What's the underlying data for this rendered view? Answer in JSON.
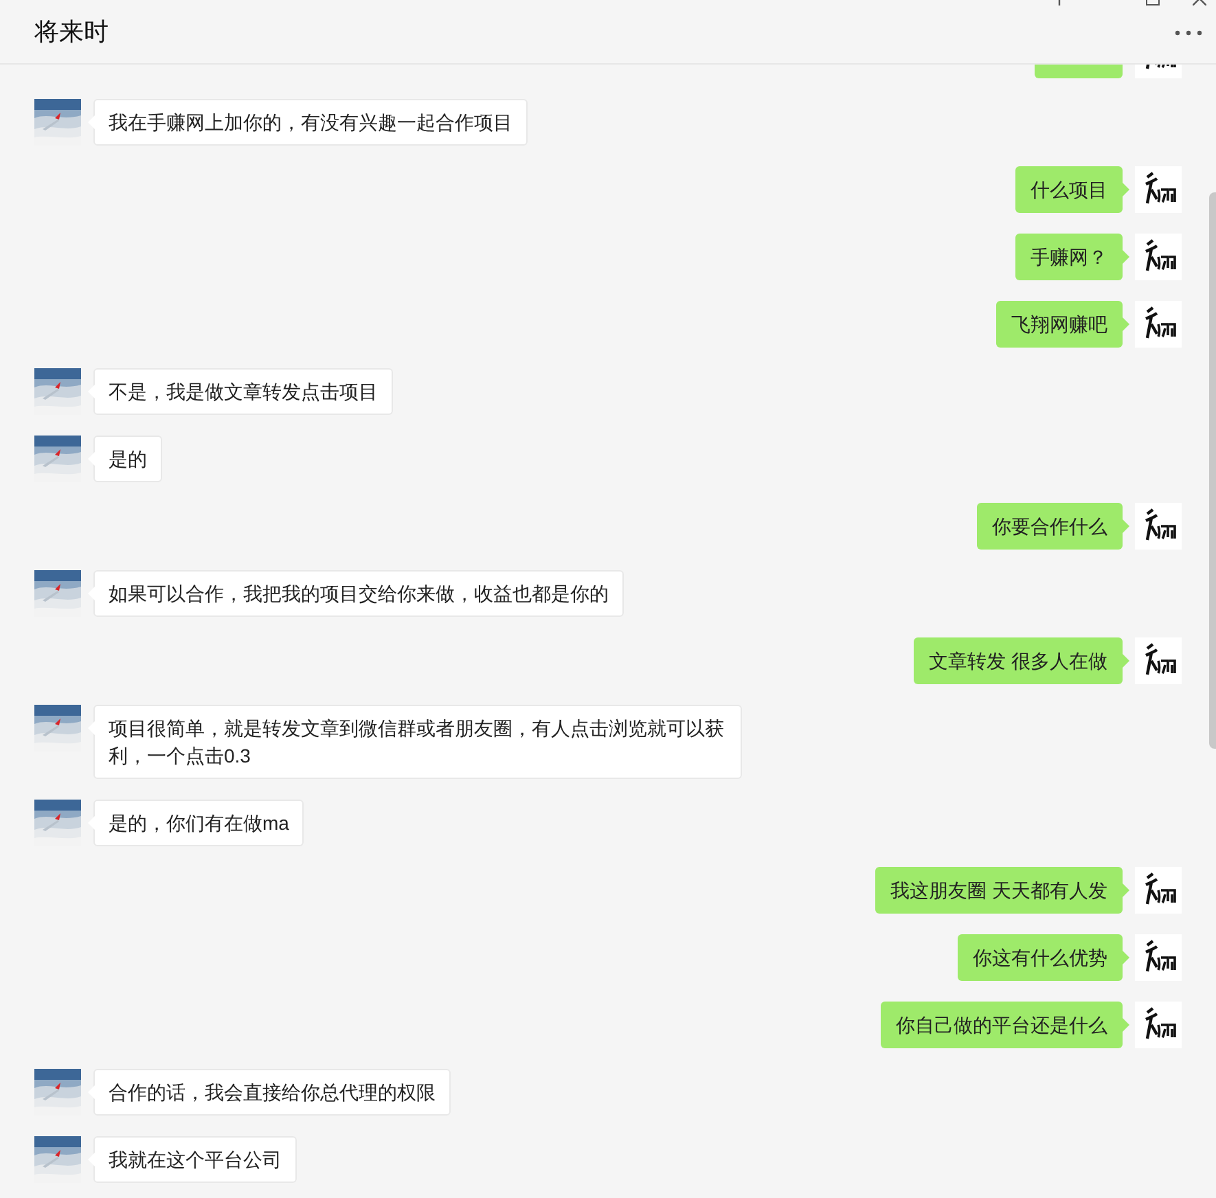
{
  "window": {
    "title": "将来时"
  },
  "messages": [
    {
      "kind": "sent",
      "cut": true
    },
    {
      "kind": "received",
      "text": "我在手赚网上加你的，有没有兴趣一起合作项目"
    },
    {
      "kind": "sent",
      "text": "什么项目"
    },
    {
      "kind": "sent",
      "text": "手赚网？"
    },
    {
      "kind": "sent",
      "text": "飞翔网赚吧"
    },
    {
      "kind": "received",
      "text": "不是，我是做文章转发点击项目"
    },
    {
      "kind": "received",
      "text": "是的"
    },
    {
      "kind": "sent",
      "text": "你要合作什么"
    },
    {
      "kind": "received",
      "text": "如果可以合作，我把我的项目交给你来做，收益也都是你的"
    },
    {
      "kind": "sent",
      "text": "文章转发 很多人在做"
    },
    {
      "kind": "received",
      "text": "项目很简单，就是转发文章到微信群或者朋友圈，有人点击浏览就可以获利，一个点击0.3"
    },
    {
      "kind": "received",
      "text": "是的，你们有在做ma"
    },
    {
      "kind": "sent",
      "text": "我这朋友圈 天天都有人发"
    },
    {
      "kind": "sent",
      "text": "你这有什么优势"
    },
    {
      "kind": "sent",
      "text": "你自己做的平台还是什么"
    },
    {
      "kind": "received",
      "text": "合作的话，我会直接给你总代理的权限"
    },
    {
      "kind": "received",
      "text": "我就在这个平台公司"
    }
  ]
}
